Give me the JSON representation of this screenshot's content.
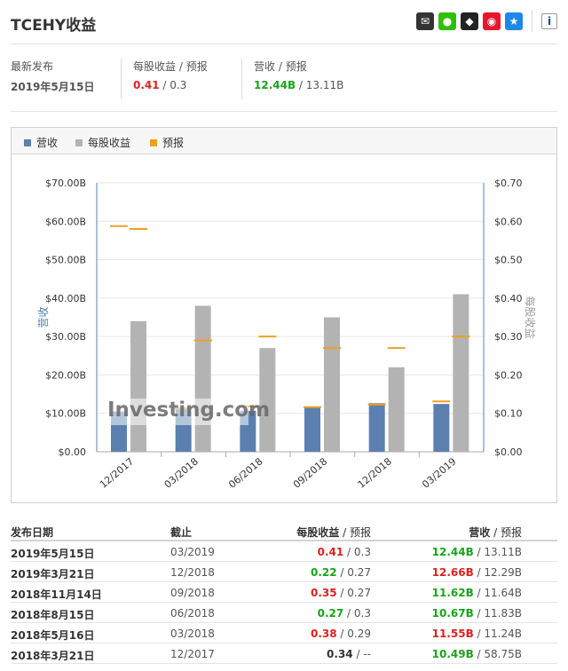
{
  "header": {
    "title": "TCEHY收益"
  },
  "share_icons": [
    {
      "name": "email-icon",
      "glyph": "✉",
      "color": "#333333"
    },
    {
      "name": "wechat-icon",
      "glyph": "●",
      "color": "#2dc100"
    },
    {
      "name": "qq-icon",
      "glyph": "◆",
      "color": "#222222"
    },
    {
      "name": "weibo-icon",
      "glyph": "◉",
      "color": "#e6162d"
    },
    {
      "name": "favorite-icon",
      "glyph": "★",
      "color": "#1e88e5"
    }
  ],
  "info_glyph": "i",
  "summary": {
    "latest": {
      "label": "最新发布",
      "value": "2019年5月15日"
    },
    "eps": {
      "label": "每股收益",
      "label2": "预报",
      "actual": "0.41",
      "forecast": "0.3",
      "slash": " / "
    },
    "revenue": {
      "label": "营收",
      "label2": "预报",
      "actual": "12.44B",
      "forecast": "13.11B",
      "slash": " / "
    }
  },
  "colors": {
    "revenue": "#5b80b0",
    "eps": "#b3b3b3",
    "forecast": "#f0a020",
    "green": "#1aa31a",
    "red": "#e02020"
  },
  "legend": {
    "revenue": "营收",
    "eps": "每股收益",
    "forecast": "预报"
  },
  "chart_data": {
    "type": "bar",
    "categories": [
      "12/2017",
      "03/2018",
      "06/2018",
      "09/2018",
      "12/2018",
      "03/2019"
    ],
    "series": [
      {
        "name": "营收",
        "axis": "left",
        "values": [
          10.49,
          11.55,
          10.67,
          11.62,
          12.66,
          12.44
        ],
        "forecast": [
          58.75,
          11.24,
          11.83,
          11.64,
          12.29,
          13.11
        ]
      },
      {
        "name": "每股收益",
        "axis": "right",
        "values": [
          0.34,
          0.38,
          0.27,
          0.35,
          0.22,
          0.41
        ],
        "forecast": [
          0.58,
          0.29,
          0.3,
          0.27,
          0.27,
          0.3
        ]
      }
    ],
    "y_left": {
      "label": "营收",
      "ticks": [
        "$0.00",
        "$10.00B",
        "$20.00B",
        "$30.00B",
        "$40.00B",
        "$50.00B",
        "$60.00B",
        "$70.00B"
      ],
      "range": [
        0,
        70
      ]
    },
    "y_right": {
      "label": "每股收益",
      "ticks": [
        "$0.00",
        "$0.10",
        "$0.20",
        "$0.30",
        "$0.40",
        "$0.50",
        "$0.60",
        "$0.70"
      ],
      "range": [
        0,
        0.7
      ]
    },
    "grid": true,
    "watermark": "Investing.com"
  },
  "table": {
    "headers": {
      "date": "发布日期",
      "period": "截止",
      "eps": "每股收益",
      "eps_forecast": "预报",
      "rev": "营收",
      "rev_forecast": "预报",
      "slash": " / "
    },
    "rows": [
      {
        "date": "2019年5月15日",
        "period": "03/2019",
        "eps": "0.41",
        "eps_color": "r",
        "eps_f": "0.3",
        "rev": "12.44B",
        "rev_color": "g",
        "rev_f": "13.11B"
      },
      {
        "date": "2019年3月21日",
        "period": "12/2018",
        "eps": "0.22",
        "eps_color": "g",
        "eps_f": "0.27",
        "rev": "12.66B",
        "rev_color": "r",
        "rev_f": "12.29B"
      },
      {
        "date": "2018年11月14日",
        "period": "09/2018",
        "eps": "0.35",
        "eps_color": "r",
        "eps_f": "0.27",
        "rev": "11.62B",
        "rev_color": "g",
        "rev_f": "11.64B"
      },
      {
        "date": "2018年8月15日",
        "period": "06/2018",
        "eps": "0.27",
        "eps_color": "g",
        "eps_f": "0.3",
        "rev": "10.67B",
        "rev_color": "g",
        "rev_f": "11.83B"
      },
      {
        "date": "2018年5月16日",
        "period": "03/2018",
        "eps": "0.38",
        "eps_color": "r",
        "eps_f": "0.29",
        "rev": "11.55B",
        "rev_color": "r",
        "rev_f": "11.24B"
      },
      {
        "date": "2018年3月21日",
        "period": "12/2017",
        "eps": "0.34",
        "eps_color": "n",
        "eps_f": "--",
        "rev": "10.49B",
        "rev_color": "g",
        "rev_f": "58.75B"
      }
    ]
  }
}
